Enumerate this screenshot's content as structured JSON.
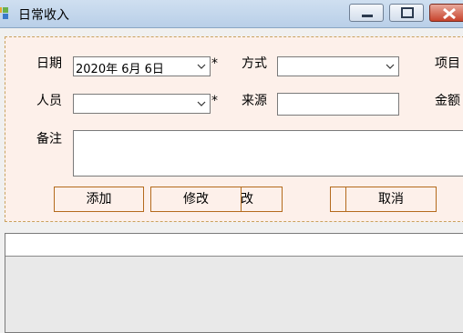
{
  "window": {
    "title": "日常收入",
    "icon": "app-icon"
  },
  "form": {
    "date_label": "日期",
    "date_value": "2020年  6月  6日",
    "date_required": "*",
    "method_label": "方式",
    "method_value": "",
    "item_label": "项目",
    "person_label": "人员",
    "person_value": "",
    "person_required": "*",
    "source_label": "来源",
    "source_value": "",
    "amount_label": "金额",
    "remark_label": "备注",
    "remark_value": ""
  },
  "buttons": {
    "add": "添加",
    "modify": "修改",
    "partial_hidden": "改",
    "cancel": "取消"
  },
  "colors": {
    "panel_bg": "#fdf0ea",
    "panel_border": "#c9a25e",
    "button_border": "#b46a1c"
  }
}
